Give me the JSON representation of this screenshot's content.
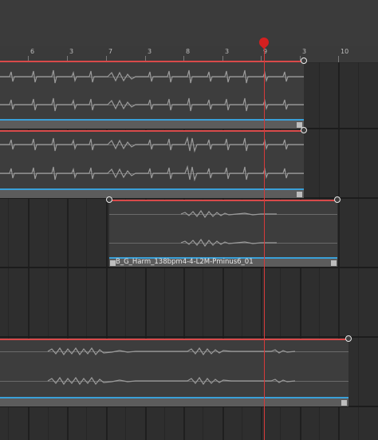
{
  "ruler": {
    "labels": [
      "6",
      "3",
      "7",
      "3",
      "8",
      "3",
      "9",
      "3",
      "10"
    ]
  },
  "clips": [
    {
      "name": ""
    },
    {
      "name": ""
    },
    {
      "name": "B_G_Harm_138bpm4-4-L2M-Pminus6_01"
    },
    {
      "name": ""
    }
  ],
  "colors": {
    "envelope": "#d84a4a",
    "clip_footer_accent": "#3aa0d8",
    "playhead": "#d42020",
    "background": "#2e2e2e"
  }
}
